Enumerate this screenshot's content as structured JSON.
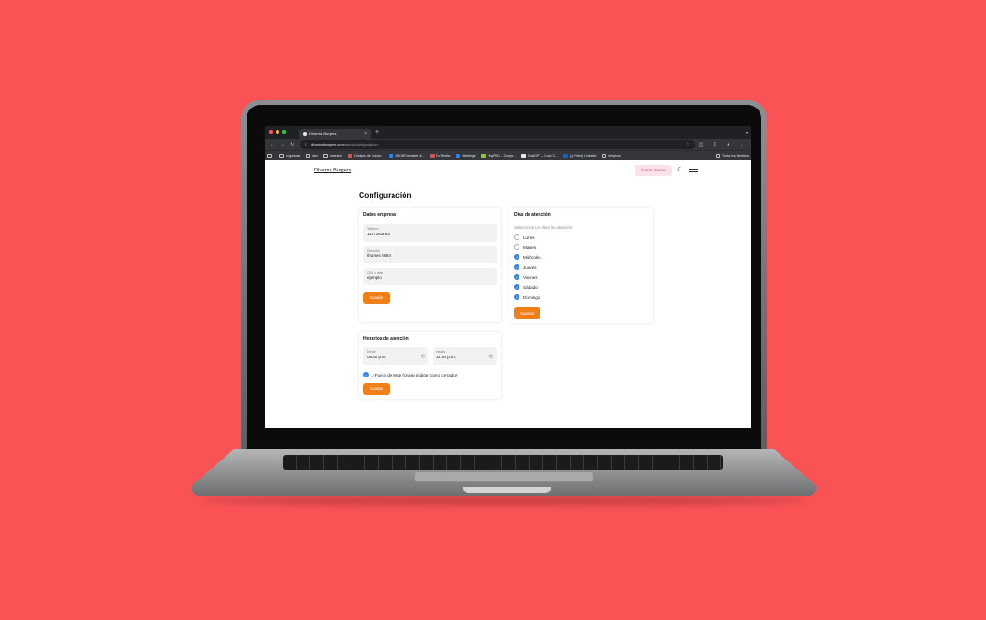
{
  "browser": {
    "tab_title": "Dharma Burgers",
    "tab_close": "×",
    "new_tab": "+",
    "url_domain": "dharmaburgers.com",
    "url_path": "/admin/configuracion",
    "bookmarks": [
      {
        "label": "seguranse",
        "color": ""
      },
      {
        "label": "dev",
        "color": ""
      },
      {
        "label": "inversion",
        "color": ""
      },
      {
        "label": "Códigos de Colore...",
        "color": "#e34b4b"
      },
      {
        "label": "JSON Formatter &...",
        "color": "#2f80ed"
      },
      {
        "label": "Tu Recibo",
        "color": "#e34b4b"
      },
      {
        "label": "Meetings",
        "color": "#2f80ed"
      },
      {
        "label": "TinyPNG – Compr...",
        "color": "#8cc63f"
      },
      {
        "label": "ChatGPT – Code C...",
        "color": "#e8eaed"
      },
      {
        "label": "(2) Feed | LinkedIn",
        "color": "#0a66c2"
      },
      {
        "label": "empleos",
        "color": ""
      }
    ],
    "all_bookmarks": "Todos los favoritos"
  },
  "header": {
    "brand": "Dharma Burgers",
    "logout_label": "Cerrar sesion"
  },
  "page": {
    "title": "Configuración"
  },
  "empresa": {
    "title": "Datos empresa",
    "fields": [
      {
        "label": "Telefono",
        "value": "1137282193"
      },
      {
        "label": "Dirección",
        "value": "thames 6884"
      },
      {
        "label": "CBU o alias",
        "value": "ejemplo"
      }
    ],
    "save_label": "Guardar"
  },
  "dias": {
    "title": "Dias de atención",
    "hint": "Seleccioná los días de atención",
    "days": [
      {
        "label": "Lunes",
        "checked": false
      },
      {
        "label": "Martes",
        "checked": false
      },
      {
        "label": "Miércoles",
        "checked": true
      },
      {
        "label": "Jueves",
        "checked": true
      },
      {
        "label": "Viernes",
        "checked": true
      },
      {
        "label": "Sábado",
        "checked": true
      },
      {
        "label": "Domingo",
        "checked": true
      }
    ],
    "save_label": "Guardar"
  },
  "horarios": {
    "title": "Horarios de atención",
    "desde_label": "Desde",
    "desde_value": "06:30 p.m.",
    "hasta_label": "Hasta",
    "hasta_value": "11:59 p.m.",
    "closed_label": "¿Fuera de este horario indicar como cerrado?",
    "closed_checked": true,
    "save_label": "Guardar"
  },
  "colors": {
    "background": "#fa5355",
    "accent": "#f07f19",
    "checkbox": "#2f80ed",
    "logout_bg": "#fde2ea"
  }
}
